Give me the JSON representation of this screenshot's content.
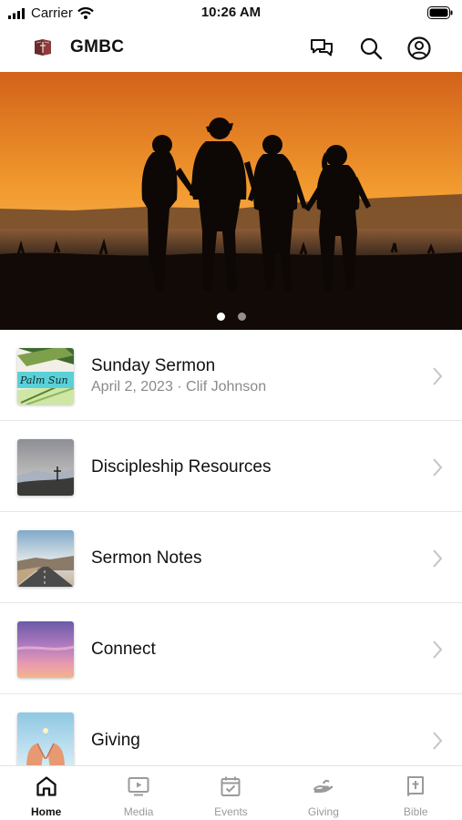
{
  "status_bar": {
    "carrier": "Carrier",
    "time": "10:26 AM"
  },
  "header": {
    "title": "GMBC"
  },
  "hero": {
    "slide_count": 2,
    "active_slide": 1
  },
  "list": [
    {
      "title": "Sunday Sermon",
      "subtitle": "April 2, 2023 · Clif Johnson",
      "thumb_text": "Palm Sun"
    },
    {
      "title": "Discipleship Resources"
    },
    {
      "title": "Sermon Notes"
    },
    {
      "title": "Connect"
    },
    {
      "title": "Giving"
    }
  ],
  "tabs": [
    {
      "label": "Home",
      "icon": "home-icon",
      "active": true
    },
    {
      "label": "Media",
      "icon": "tv-play-icon"
    },
    {
      "label": "Events",
      "icon": "calendar-check-icon"
    },
    {
      "label": "Giving",
      "icon": "giving-hand-icon"
    },
    {
      "label": "Bible",
      "icon": "bible-icon"
    }
  ],
  "colors": {
    "accent_text": "#111111",
    "inactive_tab": "#9a9a9a",
    "sunset_orange": "#e8821c"
  }
}
